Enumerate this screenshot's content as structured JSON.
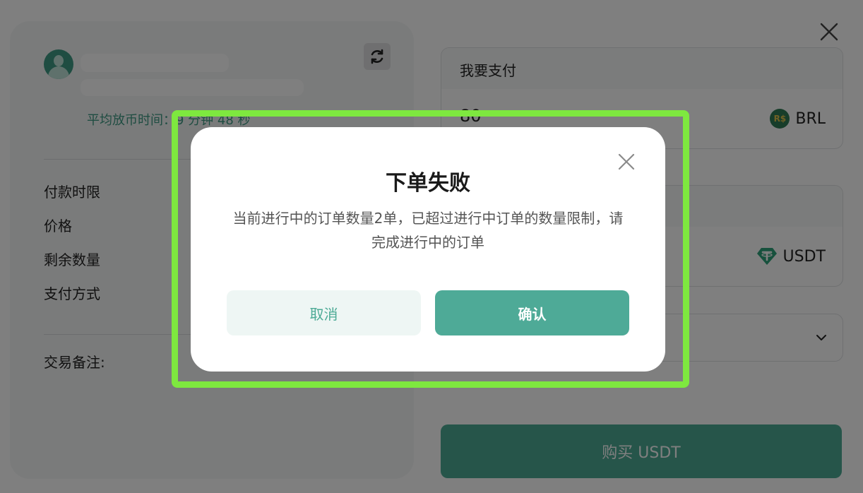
{
  "merchant": {
    "avg_release_time": "平均放币时间：9 分钟 48 秒"
  },
  "left_labels": {
    "payment_time_limit": "付款时限",
    "price": "价格",
    "remaining_quantity": "剩余数量",
    "payment_method": "支付方式",
    "trade_note": "交易备注:"
  },
  "pay_field": {
    "label": "我要支付",
    "amount": "80",
    "currency": "BRL",
    "currency_coin_glyph": "R$"
  },
  "receive_field": {
    "currency": "USDT"
  },
  "buy_button": {
    "label": "购买 USDT"
  },
  "modal": {
    "title": "下单失败",
    "message": "当前进行中的订单数量2单，已超过进行中订单的数量限制，请完成进行中的订单",
    "cancel_label": "取消",
    "confirm_label": "确认"
  },
  "colors": {
    "brand_green": "#4caa95",
    "highlight_green": "#7ee83f",
    "overlay": "rgba(0,0,0,0.5)"
  },
  "icons": {
    "refresh": "refresh-icon",
    "close": "close-icon",
    "chevron": "chevron-down-icon",
    "brl": "brl-coin-icon",
    "usdt": "usdt-coin-icon"
  }
}
